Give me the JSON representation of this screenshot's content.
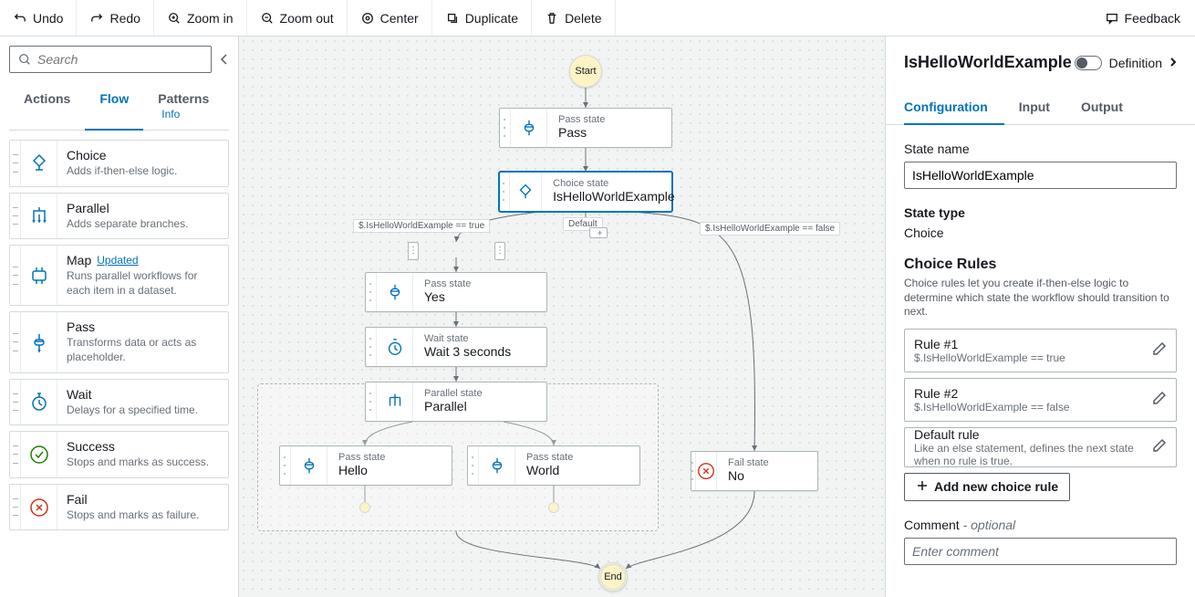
{
  "toolbar": {
    "undo": "Undo",
    "redo": "Redo",
    "zoom_in": "Zoom in",
    "zoom_out": "Zoom out",
    "center": "Center",
    "duplicate": "Duplicate",
    "delete": "Delete",
    "feedback": "Feedback"
  },
  "sidebar": {
    "search_placeholder": "Search",
    "tabs": {
      "actions": "Actions",
      "flow": "Flow",
      "patterns": "Patterns",
      "info": "Info"
    },
    "items": [
      {
        "title": "Choice",
        "desc": "Adds if-then-else logic."
      },
      {
        "title": "Parallel",
        "desc": "Adds separate branches."
      },
      {
        "title": "Map",
        "badge": "Updated",
        "desc": "Runs parallel workflows for each item in a dataset."
      },
      {
        "title": "Pass",
        "desc": "Transforms data or acts as placeholder."
      },
      {
        "title": "Wait",
        "desc": "Delays for a specified time."
      },
      {
        "title": "Success",
        "desc": "Stops and marks as success."
      },
      {
        "title": "Fail",
        "desc": "Stops and marks as failure."
      }
    ]
  },
  "canvas": {
    "start": "Start",
    "end": "End",
    "nodes": {
      "pass1": {
        "type": "Pass state",
        "name": "Pass"
      },
      "choice": {
        "type": "Choice state",
        "name": "IsHelloWorldExample"
      },
      "yes": {
        "type": "Pass state",
        "name": "Yes"
      },
      "wait": {
        "type": "Wait state",
        "name": "Wait 3 seconds"
      },
      "parallel": {
        "type": "Parallel state",
        "name": "Parallel"
      },
      "hello": {
        "type": "Pass state",
        "name": "Hello"
      },
      "world": {
        "type": "Pass state",
        "name": "World"
      },
      "no": {
        "type": "Fail state",
        "name": "No"
      }
    },
    "labels": {
      "true": "$.IsHelloWorldExample == true",
      "default": "Default",
      "false": "$.IsHelloWorldExample == false"
    }
  },
  "inspector": {
    "title": "IsHelloWorldExample",
    "definition": "Definition",
    "tabs": {
      "configuration": "Configuration",
      "input": "Input",
      "output": "Output"
    },
    "state_name_label": "State name",
    "state_name_value": "IsHelloWorldExample",
    "state_type_label": "State type",
    "state_type_value": "Choice",
    "rules_title": "Choice Rules",
    "rules_desc": "Choice rules let you create if-then-else logic to determine which state the workflow should transition to next.",
    "rules": [
      {
        "name": "Rule #1",
        "cond": "$.IsHelloWorldExample == true"
      },
      {
        "name": "Rule #2",
        "cond": "$.IsHelloWorldExample == false"
      },
      {
        "name": "Default rule",
        "cond": "Like an else statement, defines the next state when no rule is true."
      }
    ],
    "add_rule": "Add new choice rule",
    "comment_label": "Comment",
    "comment_optional": "- optional",
    "comment_placeholder": "Enter comment"
  }
}
